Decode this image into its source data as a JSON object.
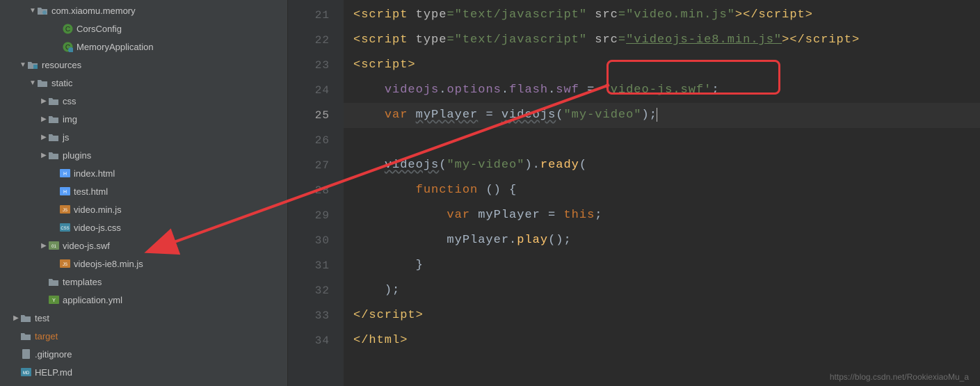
{
  "tree": [
    {
      "indent": 24,
      "arrow": "down",
      "icon": "pkg",
      "label": "com.xiaomu.memory"
    },
    {
      "indent": 60,
      "arrow": "",
      "icon": "class-c",
      "label": "CorsConfig"
    },
    {
      "indent": 60,
      "arrow": "",
      "icon": "class-g",
      "label": "MemoryApplication"
    },
    {
      "indent": 10,
      "arrow": "down",
      "icon": "res",
      "label": "resources"
    },
    {
      "indent": 24,
      "arrow": "down",
      "icon": "folder",
      "label": "static"
    },
    {
      "indent": 40,
      "arrow": "right",
      "icon": "folder",
      "label": "css"
    },
    {
      "indent": 40,
      "arrow": "right",
      "icon": "folder",
      "label": "img"
    },
    {
      "indent": 40,
      "arrow": "right",
      "icon": "folder",
      "label": "js"
    },
    {
      "indent": 40,
      "arrow": "right",
      "icon": "folder",
      "label": "plugins"
    },
    {
      "indent": 56,
      "arrow": "",
      "icon": "html",
      "label": "index.html"
    },
    {
      "indent": 56,
      "arrow": "",
      "icon": "html",
      "label": "test.html"
    },
    {
      "indent": 56,
      "arrow": "",
      "icon": "js",
      "label": "video.min.js"
    },
    {
      "indent": 56,
      "arrow": "",
      "icon": "css",
      "label": "video-js.css"
    },
    {
      "indent": 40,
      "arrow": "right",
      "icon": "swf",
      "label": "video-js.swf"
    },
    {
      "indent": 56,
      "arrow": "",
      "icon": "js",
      "label": "videojs-ie8.min.js"
    },
    {
      "indent": 40,
      "arrow": "",
      "icon": "folder",
      "label": "templates"
    },
    {
      "indent": 40,
      "arrow": "",
      "icon": "yml",
      "label": "application.yml"
    },
    {
      "indent": 0,
      "arrow": "right",
      "icon": "folder",
      "label": "test"
    },
    {
      "indent": 0,
      "arrow": "",
      "icon": "folder",
      "label": "target",
      "orange": true
    },
    {
      "indent": 0,
      "arrow": "",
      "icon": "file",
      "label": ".gitignore"
    },
    {
      "indent": 0,
      "arrow": "",
      "icon": "md",
      "label": "HELP.md"
    }
  ],
  "lineNumbers": [
    21,
    22,
    23,
    24,
    25,
    26,
    27,
    28,
    29,
    30,
    31,
    32,
    33,
    34
  ],
  "activeLine": 25,
  "code": {
    "l21": {
      "tag": "script",
      "attr1": "type",
      "val1": "\"text/javascript\"",
      "attr2": "src",
      "val2": "\"video.min.js\"",
      "close": "script"
    },
    "l22": {
      "tag": "script",
      "attr1": "type",
      "val1": "\"text/javascript\"",
      "attr2": "src",
      "val2": "\"videojs-ie8.min.js\"",
      "close": "script"
    },
    "l23": {
      "open": "<",
      "tag": "script",
      "close": ">"
    },
    "l24": {
      "a": "videojs",
      "b": ".",
      "c": "options",
      "d": ".",
      "e": "flash",
      "f": ".",
      "g": "swf",
      "eq": " = ",
      "str": "'video-js.swf'",
      "semi": ";"
    },
    "l25": {
      "kw": "var",
      "sp": " ",
      "name": "myPlayer",
      "eq": " = ",
      "fn": "videojs",
      "open": "(",
      "arg": "\"my-video\"",
      "close": ");"
    },
    "l27": {
      "fn": "videojs",
      "open": "(",
      "arg": "\"my-video\"",
      "close": ").",
      "ready": "ready",
      "paren": "("
    },
    "l28": {
      "kw": "function",
      "rest": " () {"
    },
    "l29": {
      "kw": "var",
      "sp": " ",
      "name": "myPlayer",
      "eq": " = ",
      "this": "this",
      "semi": ";"
    },
    "l30": {
      "a": "myPlayer.",
      "b": "play",
      "c": "();"
    },
    "l31": {
      "txt": "}"
    },
    "l32": {
      "txt": ");"
    },
    "l33": {
      "open": "</",
      "tag": "script",
      "close": ">"
    },
    "l34": {
      "open": "</",
      "tag": "html",
      "close": ">"
    }
  },
  "watermark": "https://blog.csdn.net/RookiexiaoMu_a"
}
